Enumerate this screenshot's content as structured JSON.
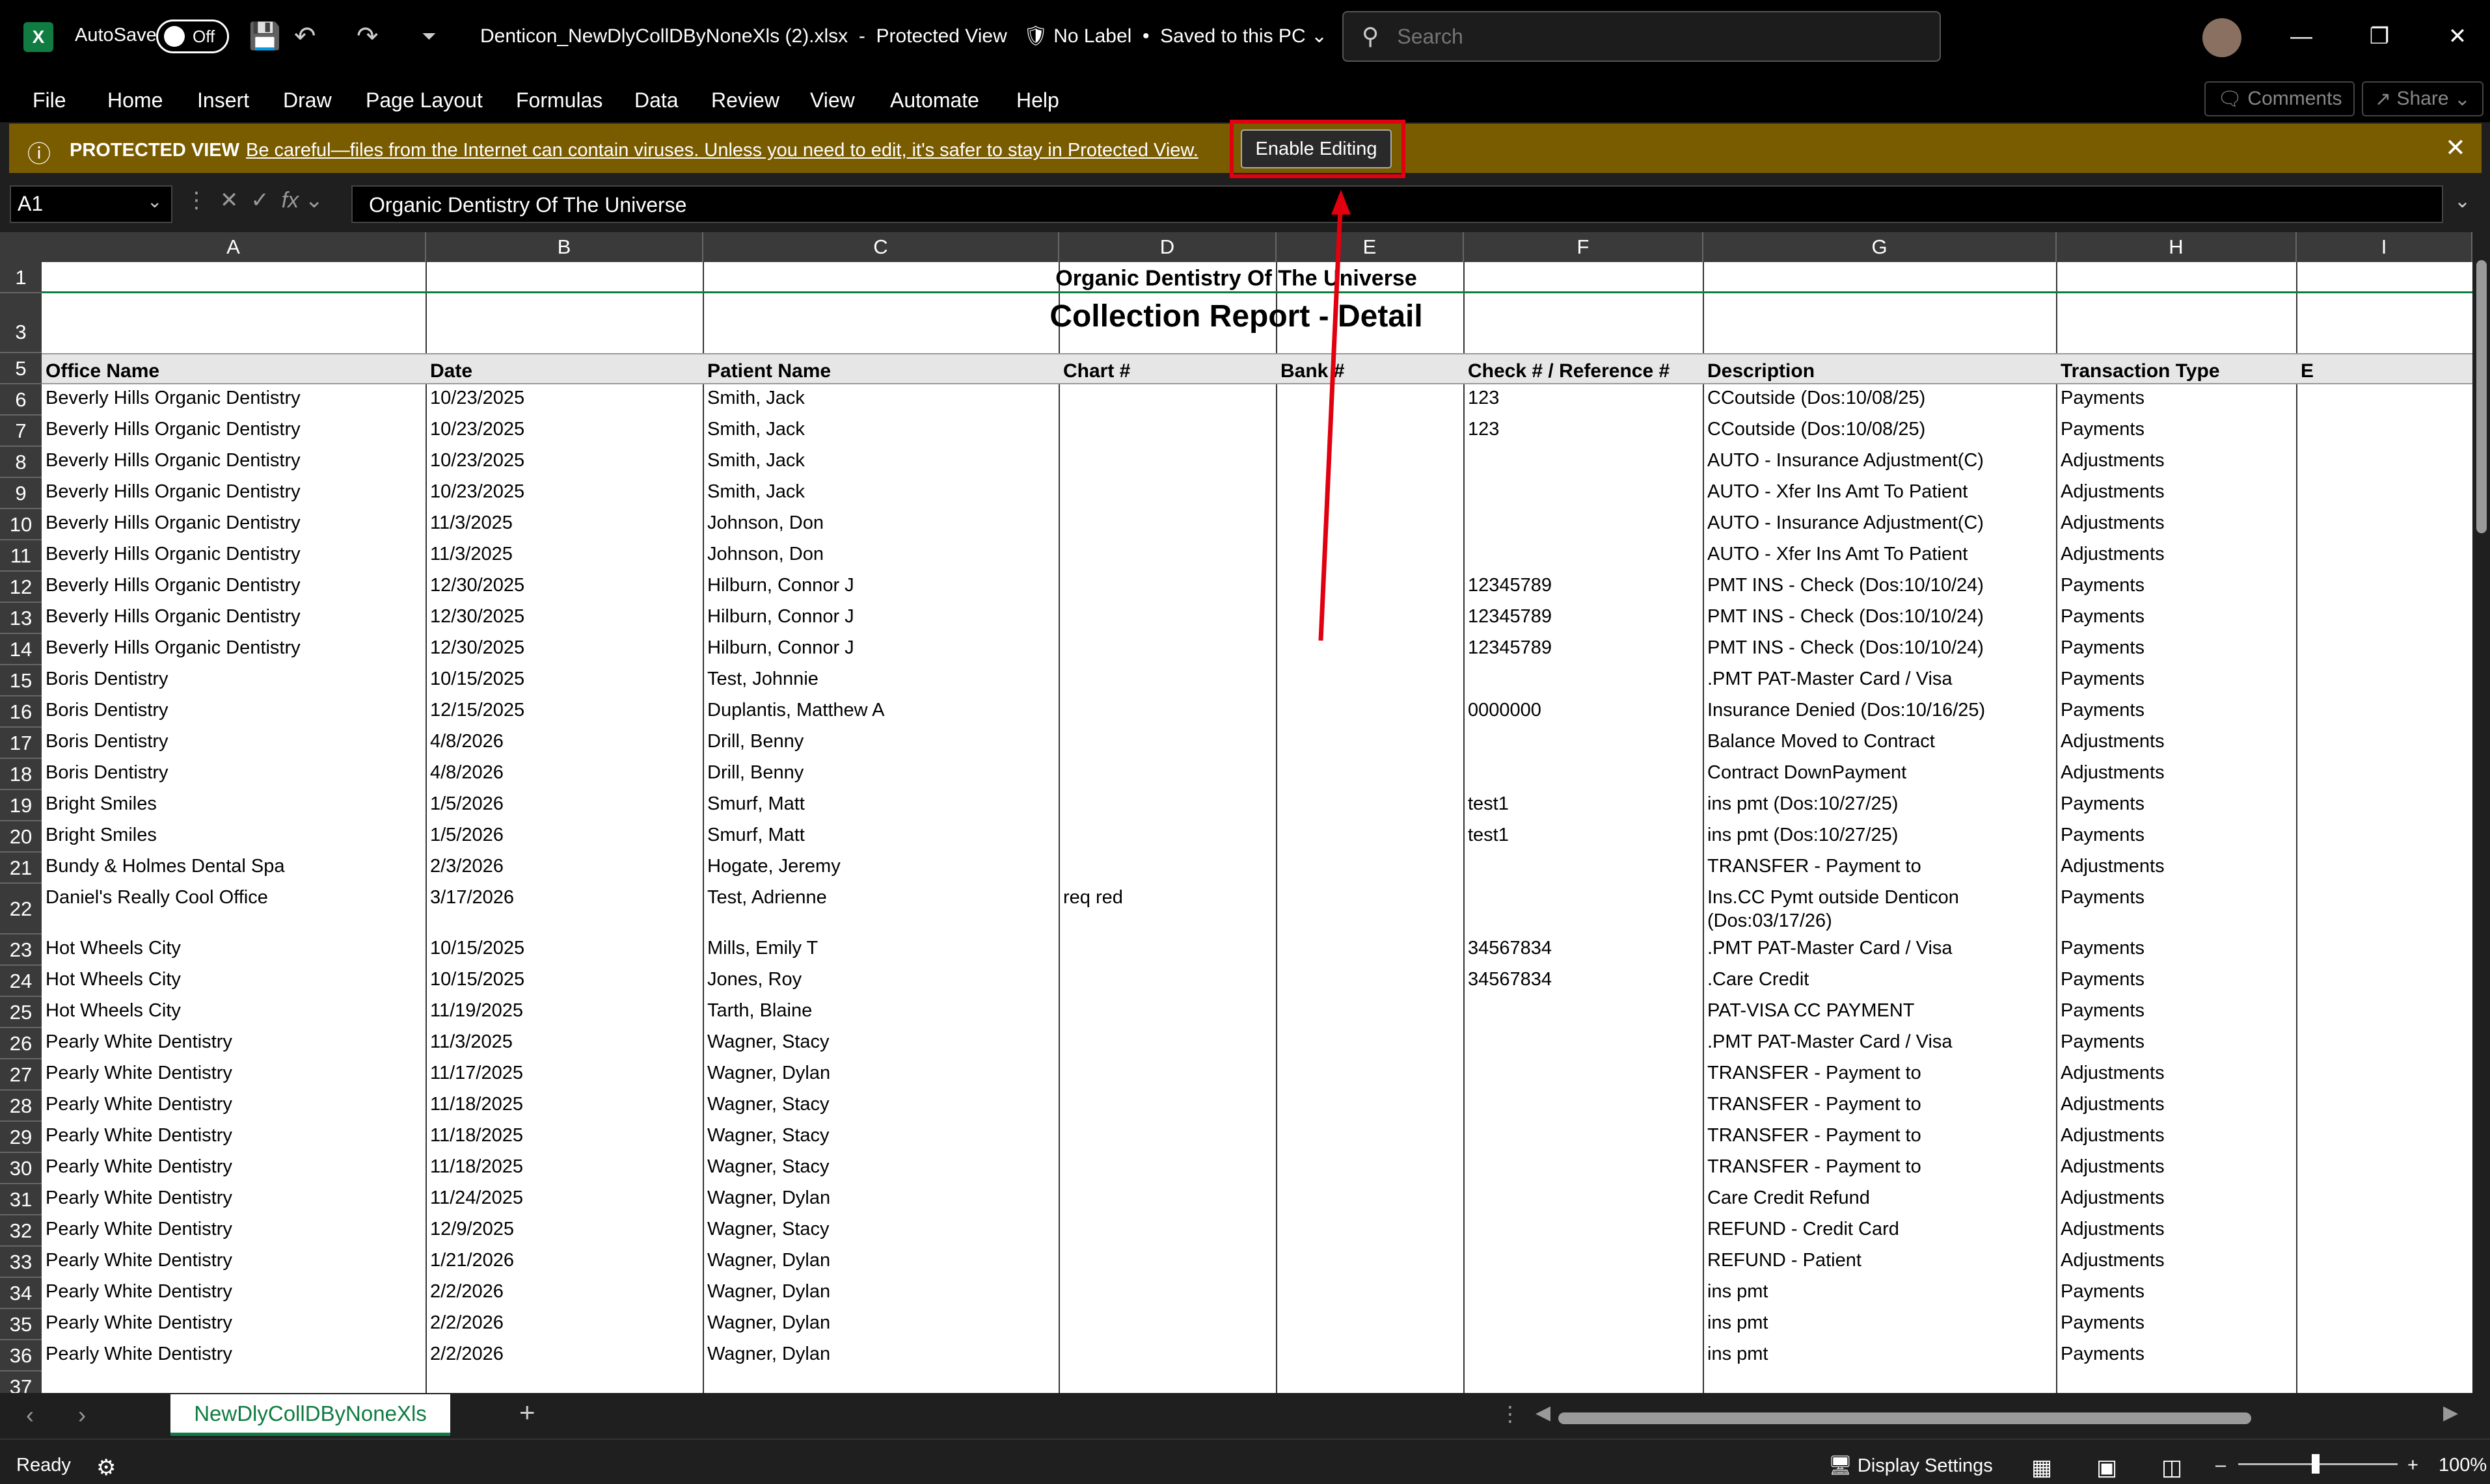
{
  "titlebar": {
    "autosave_label": "AutoSave",
    "autosave_state": "Off",
    "file_name": "Denticon_NewDlyCollDByNoneXls (2).xlsx",
    "mode": "Protected View",
    "label": "No Label",
    "save_state": "Saved to this PC",
    "search_placeholder": "Search"
  },
  "menu": [
    "File",
    "Home",
    "Insert",
    "Draw",
    "Page Layout",
    "Formulas",
    "Data",
    "Review",
    "View",
    "Automate",
    "Help"
  ],
  "top_buttons": {
    "comments": "Comments",
    "share": "Share"
  },
  "protected_view": {
    "title": "PROTECTED VIEW",
    "message": "Be careful—files from the Internet can contain viruses. Unless you need to edit, it's safer to stay in Protected View.",
    "button": "Enable Editing"
  },
  "formula_bar": {
    "name_box": "A1",
    "formula": "Organic Dentistry Of The Universe"
  },
  "columns": [
    "A",
    "B",
    "C",
    "D",
    "E",
    "F",
    "G",
    "H",
    "I"
  ],
  "report": {
    "title": "Organic Dentistry Of The Universe",
    "subtitle": "Collection Report - Detail"
  },
  "headers": [
    "Office Name",
    "Date",
    "Patient Name",
    "Chart #",
    "Bank #",
    "Check # / Reference #",
    "Description",
    "Transaction Type",
    "E"
  ],
  "rows": [
    {
      "r": "6",
      "c": [
        "Beverly Hills Organic Dentistry",
        "10/23/2025",
        "Smith, Jack",
        "",
        "",
        "123",
        "CCoutside (Dos:10/08/25)",
        "Payments"
      ]
    },
    {
      "r": "7",
      "c": [
        "Beverly Hills Organic Dentistry",
        "10/23/2025",
        "Smith, Jack",
        "",
        "",
        "123",
        "CCoutside (Dos:10/08/25)",
        "Payments"
      ]
    },
    {
      "r": "8",
      "c": [
        "Beverly Hills Organic Dentistry",
        "10/23/2025",
        "Smith, Jack",
        "",
        "",
        "",
        "AUTO - Insurance Adjustment(C)",
        "Adjustments"
      ]
    },
    {
      "r": "9",
      "c": [
        "Beverly Hills Organic Dentistry",
        "10/23/2025",
        "Smith, Jack",
        "",
        "",
        "",
        "AUTO - Xfer Ins Amt To Patient",
        "Adjustments"
      ]
    },
    {
      "r": "10",
      "c": [
        "Beverly Hills Organic Dentistry",
        "11/3/2025",
        "Johnson, Don",
        "",
        "",
        "",
        "AUTO - Insurance Adjustment(C)",
        "Adjustments"
      ]
    },
    {
      "r": "11",
      "c": [
        "Beverly Hills Organic Dentistry",
        "11/3/2025",
        "Johnson, Don",
        "",
        "",
        "",
        "AUTO - Xfer Ins Amt To Patient",
        "Adjustments"
      ]
    },
    {
      "r": "12",
      "c": [
        "Beverly Hills Organic Dentistry",
        "12/30/2025",
        "Hilburn, Connor J",
        "",
        "",
        "12345789",
        "PMT INS - Check (Dos:10/10/24)",
        "Payments"
      ]
    },
    {
      "r": "13",
      "c": [
        "Beverly Hills Organic Dentistry",
        "12/30/2025",
        "Hilburn, Connor J",
        "",
        "",
        "12345789",
        "PMT INS - Check (Dos:10/10/24)",
        "Payments"
      ]
    },
    {
      "r": "14",
      "c": [
        "Beverly Hills Organic Dentistry",
        "12/30/2025",
        "Hilburn, Connor J",
        "",
        "",
        "12345789",
        "PMT INS - Check (Dos:10/10/24)",
        "Payments"
      ]
    },
    {
      "r": "15",
      "c": [
        "Boris Dentistry",
        "10/15/2025",
        "Test, Johnnie",
        "",
        "",
        "",
        ".PMT PAT-Master Card / Visa",
        "Payments"
      ]
    },
    {
      "r": "16",
      "c": [
        "Boris Dentistry",
        "12/15/2025",
        "Duplantis, Matthew A",
        "",
        "",
        "0000000",
        "Insurance Denied (Dos:10/16/25)",
        "Payments"
      ]
    },
    {
      "r": "17",
      "c": [
        "Boris Dentistry",
        "4/8/2026",
        "Drill, Benny",
        "",
        "",
        "",
        "Balance Moved to Contract",
        "Adjustments"
      ]
    },
    {
      "r": "18",
      "c": [
        "Boris Dentistry",
        "4/8/2026",
        "Drill, Benny",
        "",
        "",
        "",
        "Contract DownPayment",
        "Adjustments"
      ]
    },
    {
      "r": "19",
      "c": [
        "Bright Smiles",
        "1/5/2026",
        "Smurf, Matt",
        "",
        "",
        "test1",
        "ins pmt (Dos:10/27/25)",
        "Payments"
      ]
    },
    {
      "r": "20",
      "c": [
        "Bright Smiles",
        "1/5/2026",
        "Smurf, Matt",
        "",
        "",
        "test1",
        "ins pmt (Dos:10/27/25)",
        "Payments"
      ]
    },
    {
      "r": "21",
      "c": [
        "Bundy & Holmes Dental Spa",
        "2/3/2026",
        "Hogate, Jeremy",
        "",
        "",
        "",
        "TRANSFER - Payment to",
        "Adjustments"
      ]
    },
    {
      "r": "22",
      "c": [
        "Daniel's Really Cool Office",
        "3/17/2026",
        "Test, Adrienne",
        "req red",
        "",
        "",
        "Ins.CC Pymt outside Denticon",
        "Payments"
      ],
      "c2": "(Dos:03/17/26)"
    },
    {
      "r": "23",
      "c": [
        "Hot Wheels City",
        "10/15/2025",
        "Mills, Emily T",
        "",
        "",
        "34567834",
        ".PMT PAT-Master Card / Visa",
        "Payments"
      ]
    },
    {
      "r": "24",
      "c": [
        "Hot Wheels City",
        "10/15/2025",
        "Jones, Roy",
        "",
        "",
        "34567834",
        ".Care Credit",
        "Payments"
      ]
    },
    {
      "r": "25",
      "c": [
        "Hot Wheels City",
        "11/19/2025",
        "Tarth, Blaine",
        "",
        "",
        "",
        "PAT-VISA CC PAYMENT",
        "Payments"
      ]
    },
    {
      "r": "26",
      "c": [
        "Pearly White Dentistry",
        "11/3/2025",
        "Wagner, Stacy",
        "",
        "",
        "",
        ".PMT PAT-Master Card / Visa",
        "Payments"
      ]
    },
    {
      "r": "27",
      "c": [
        "Pearly White Dentistry",
        "11/17/2025",
        "Wagner, Dylan",
        "",
        "",
        "",
        "TRANSFER - Payment to",
        "Adjustments"
      ]
    },
    {
      "r": "28",
      "c": [
        "Pearly White Dentistry",
        "11/18/2025",
        "Wagner, Stacy",
        "",
        "",
        "",
        "TRANSFER - Payment to",
        "Adjustments"
      ]
    },
    {
      "r": "29",
      "c": [
        "Pearly White Dentistry",
        "11/18/2025",
        "Wagner, Stacy",
        "",
        "",
        "",
        "TRANSFER - Payment to",
        "Adjustments"
      ]
    },
    {
      "r": "30",
      "c": [
        "Pearly White Dentistry",
        "11/18/2025",
        "Wagner, Stacy",
        "",
        "",
        "",
        "TRANSFER - Payment to",
        "Adjustments"
      ]
    },
    {
      "r": "31",
      "c": [
        "Pearly White Dentistry",
        "11/24/2025",
        "Wagner, Dylan",
        "",
        "",
        "",
        "Care Credit Refund",
        "Adjustments"
      ]
    },
    {
      "r": "32",
      "c": [
        "Pearly White Dentistry",
        "12/9/2025",
        "Wagner, Stacy",
        "",
        "",
        "",
        "REFUND - Credit Card",
        "Adjustments"
      ]
    },
    {
      "r": "33",
      "c": [
        "Pearly White Dentistry",
        "1/21/2026",
        "Wagner, Dylan",
        "",
        "",
        "",
        "REFUND - Patient",
        "Adjustments"
      ]
    },
    {
      "r": "34",
      "c": [
        "Pearly White Dentistry",
        "2/2/2026",
        "Wagner, Dylan",
        "",
        "",
        "",
        "ins pmt",
        "Payments"
      ]
    },
    {
      "r": "35",
      "c": [
        "Pearly White Dentistry",
        "2/2/2026",
        "Wagner, Dylan",
        "",
        "",
        "",
        "ins pmt",
        "Payments"
      ]
    },
    {
      "r": "36",
      "c": [
        "Pearly White Dentistry",
        "2/2/2026",
        "Wagner, Dylan",
        "",
        "",
        "",
        "ins pmt",
        "Payments"
      ]
    }
  ],
  "sheet_tab": "NewDlyCollDByNoneXls",
  "status": {
    "ready": "Ready",
    "display_settings": "Display Settings",
    "zoom": "100%"
  },
  "colors": {
    "excel_green": "#107c41",
    "protected_bar": "#7a5c00",
    "highlight": "#e0000f"
  }
}
